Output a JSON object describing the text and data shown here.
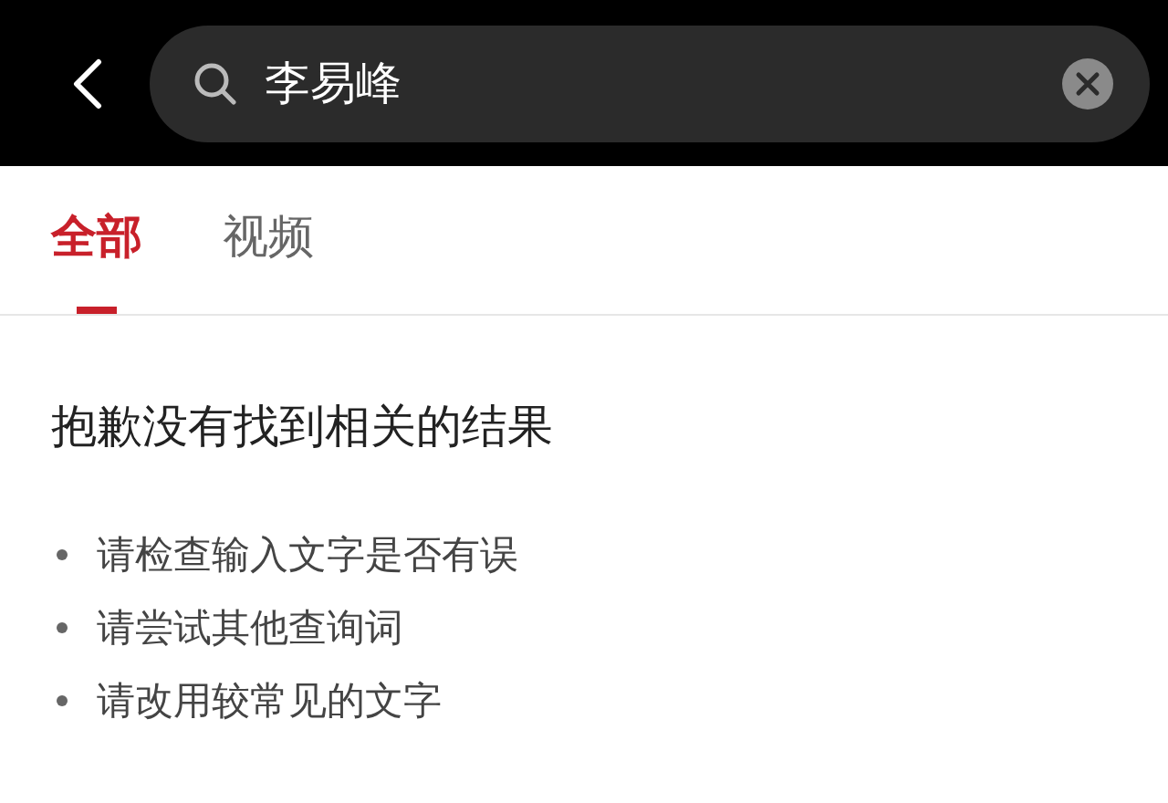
{
  "search": {
    "value": "李易峰"
  },
  "tabs": [
    {
      "label": "全部",
      "selected": true
    },
    {
      "label": "视频",
      "selected": false
    }
  ],
  "empty_state": {
    "title": "抱歉没有找到相关的结果",
    "suggestions": [
      "请检查输入文字是否有误",
      "请尝试其他查询词",
      "请改用较常见的文字"
    ]
  }
}
